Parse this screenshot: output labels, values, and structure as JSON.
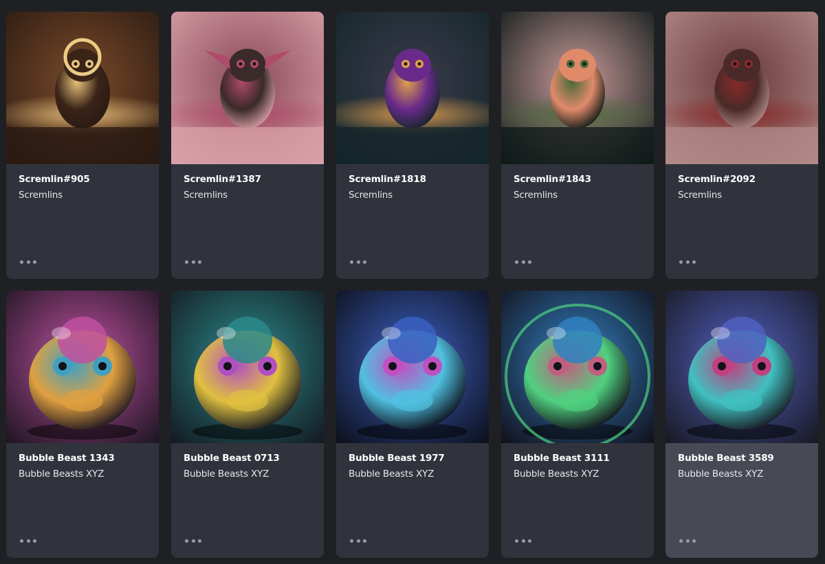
{
  "items": [
    {
      "title": "Scremlin#905",
      "collection": "Scremlins",
      "art": "scremlin-halo-image",
      "colors": [
        "#2a1a12",
        "#7a4a2a",
        "#e8c07a",
        "#3a2418"
      ]
    },
    {
      "title": "Scremlin#1387",
      "collection": "Scremlins",
      "art": "scremlin-pink-winged-image",
      "colors": [
        "#d9a0a8",
        "#8a4a5a",
        "#b04a6a",
        "#3a2a2a"
      ]
    },
    {
      "title": "Scremlin#1818",
      "collection": "Scremlins",
      "art": "scremlin-furry-image",
      "colors": [
        "#14262a",
        "#3a3a4a",
        "#e0a04a",
        "#6a2a8a"
      ]
    },
    {
      "title": "Scremlin#1843",
      "collection": "Scremlins",
      "art": "scremlin-white-green-image",
      "colors": [
        "#0e1a18",
        "#c89a9a",
        "#4a6a3a",
        "#e08a6a"
      ]
    },
    {
      "title": "Scremlin#2092",
      "collection": "Scremlins",
      "art": "scremlin-red-field-image",
      "colors": [
        "#b08a88",
        "#6a3a3a",
        "#8a2a2a",
        "#4a2a28"
      ]
    },
    {
      "title": "Bubble Beast 1343",
      "collection": "Bubble Beasts XYZ",
      "art": "bubble-beast-rainbow-image",
      "colors": [
        "#1a1420",
        "#c050a0",
        "#40a0c0",
        "#e0a040"
      ]
    },
    {
      "title": "Bubble Beast 0713",
      "collection": "Bubble Beasts XYZ",
      "art": "bubble-beast-teal-image",
      "colors": [
        "#141820",
        "#2a8a8a",
        "#b050c0",
        "#e0c040"
      ]
    },
    {
      "title": "Bubble Beast 1977",
      "collection": "Bubble Beasts XYZ",
      "art": "bubble-beast-blue-image",
      "colors": [
        "#0c0e18",
        "#3a60c0",
        "#c050c0",
        "#50c0e0"
      ]
    },
    {
      "title": "Bubble Beast 3111",
      "collection": "Bubble Beasts XYZ",
      "art": "bubble-beast-sphere-image",
      "colors": [
        "#120e18",
        "#3080c0",
        "#c06080",
        "#50d080"
      ]
    },
    {
      "title": "Bubble Beast 3589",
      "collection": "Bubble Beasts XYZ",
      "art": "bubble-beast-crystal-image",
      "colors": [
        "#181820",
        "#5060c0",
        "#c04080",
        "#40c0c0"
      ],
      "hovered": true
    }
  ],
  "more_icon": "more-horizontal-icon"
}
